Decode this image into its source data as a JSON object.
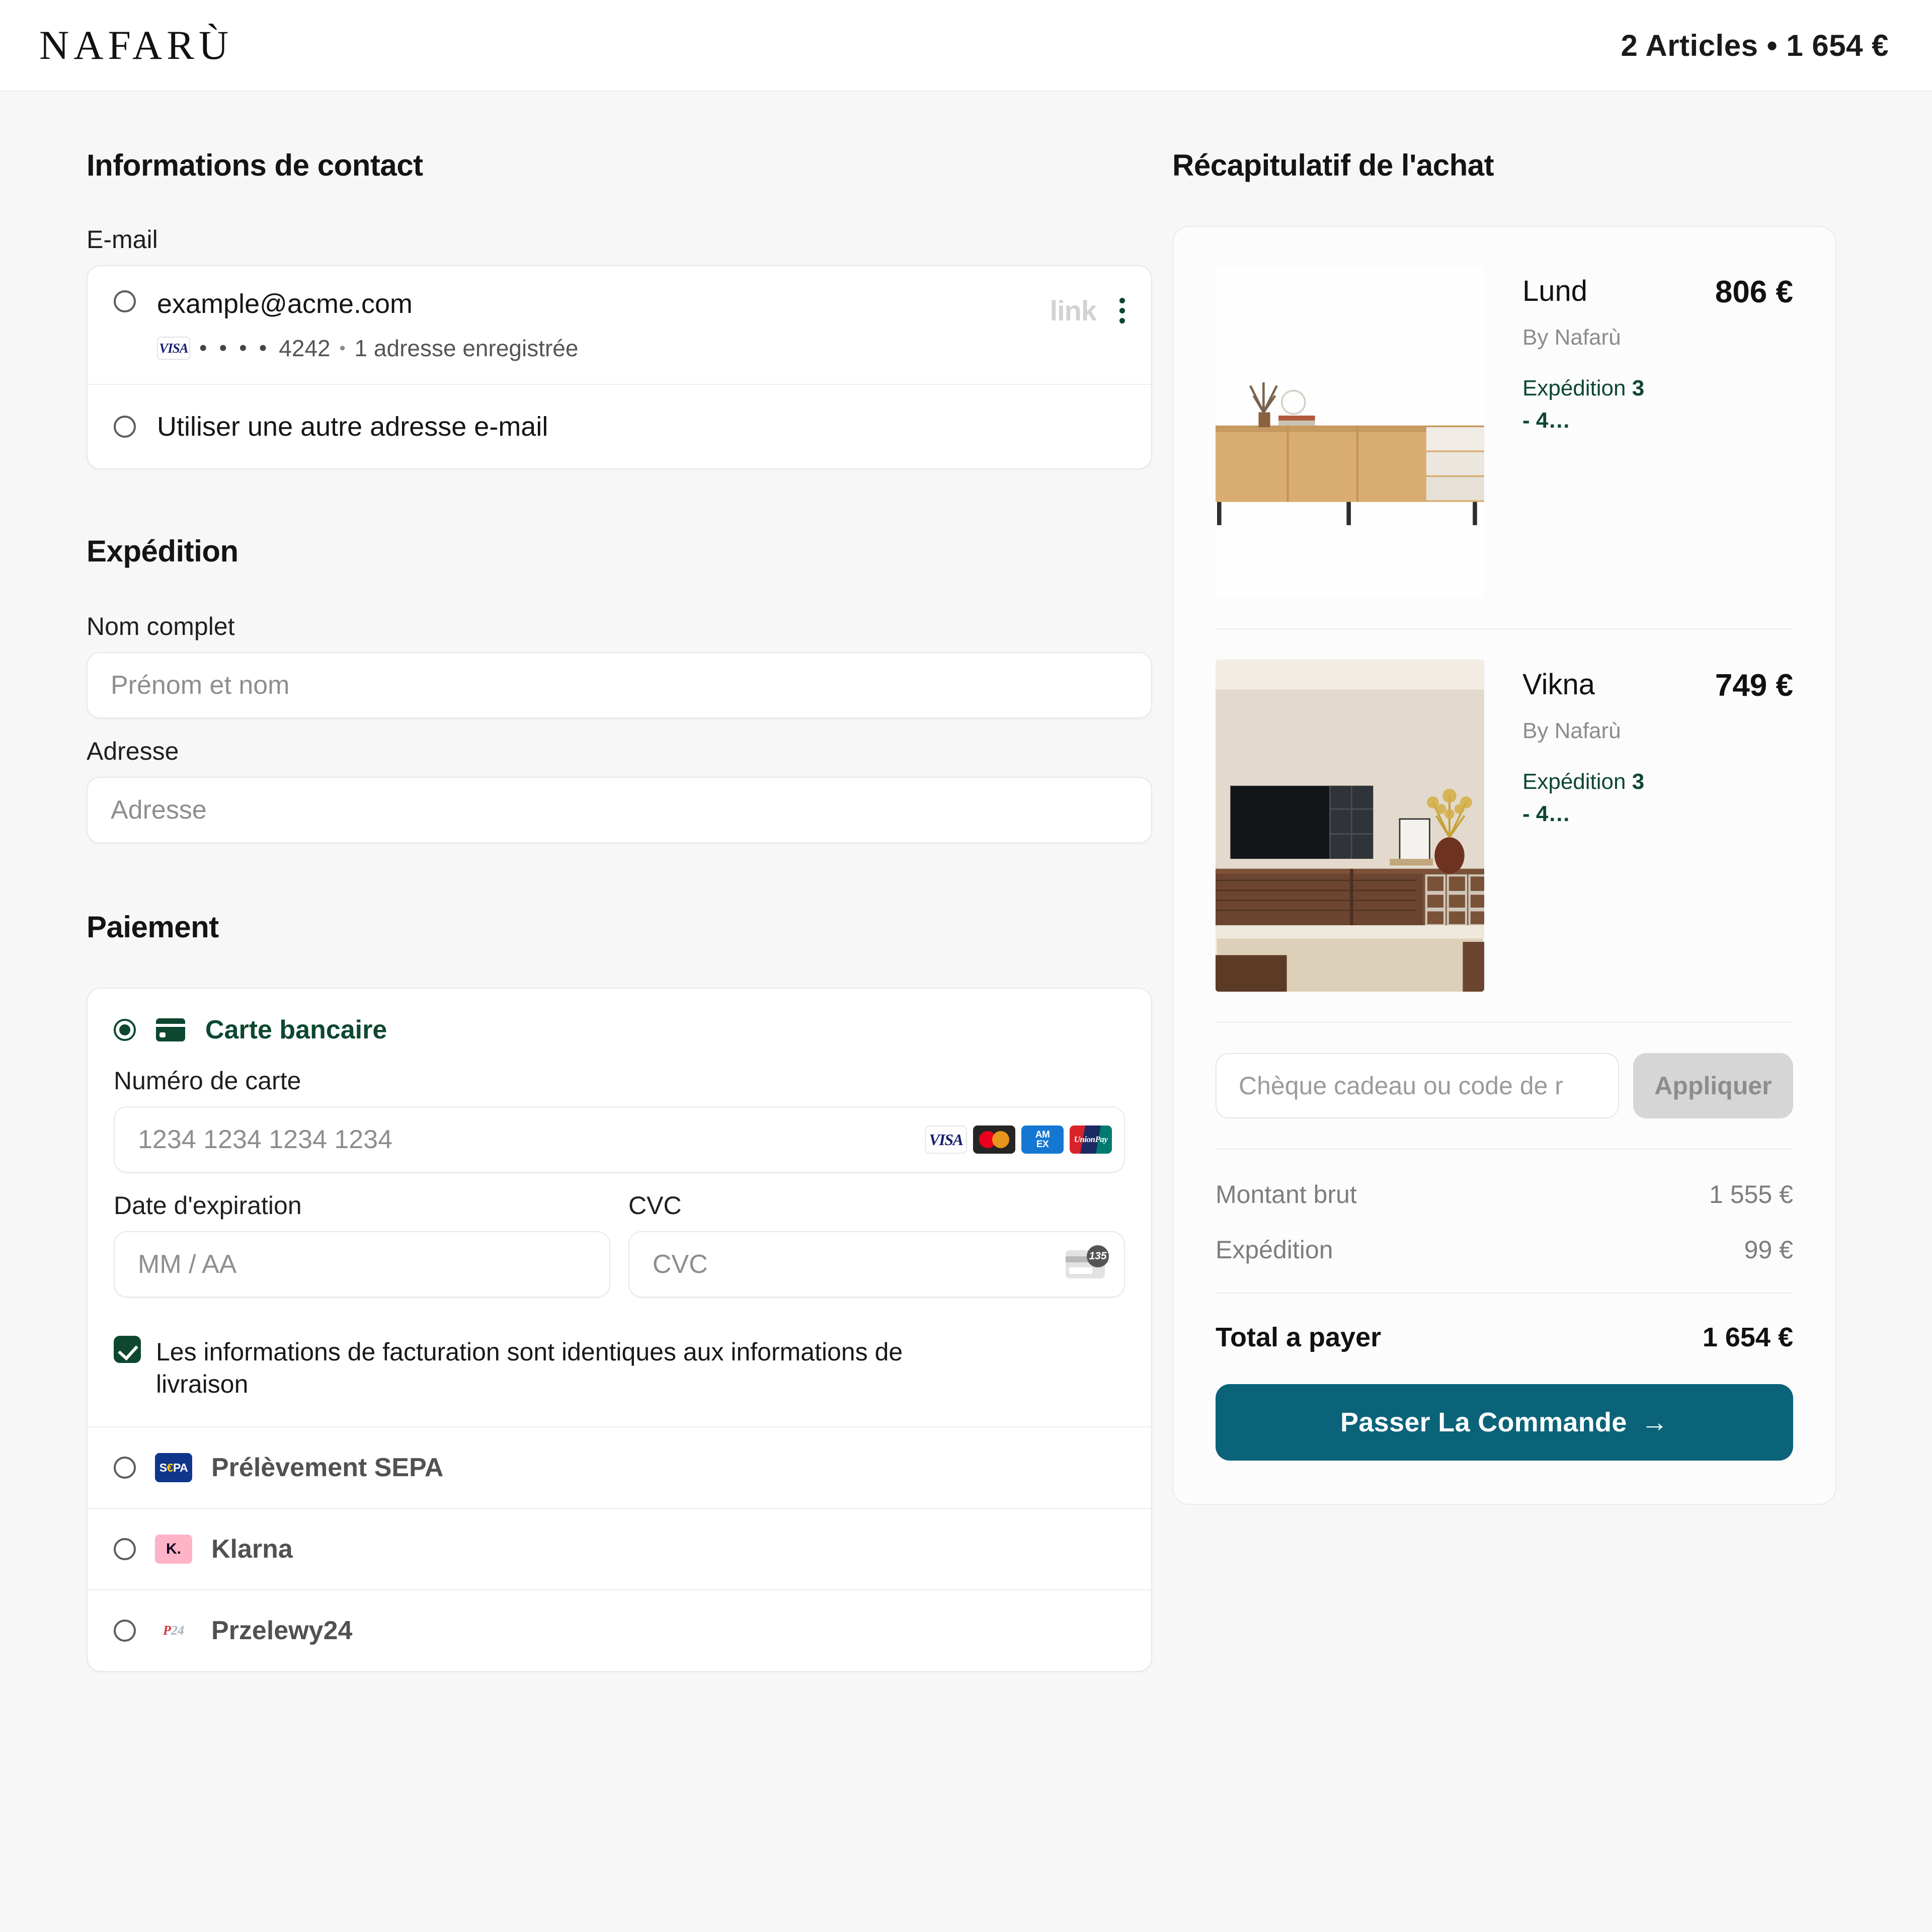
{
  "header": {
    "brand": "NAFARÙ",
    "cart_summary": "2 Articles • 1 654 €"
  },
  "contact": {
    "title": "Informations de contact",
    "email_label": "E-mail",
    "saved": {
      "email": "example@acme.com",
      "card_brand": "VISA",
      "masked_digits": "• • • •",
      "last4": "4242",
      "separator": "•",
      "address_note": "1 adresse enregistrée",
      "wallet_logo": "link"
    },
    "other_email_option": "Utiliser une autre adresse e-mail"
  },
  "shipping": {
    "title": "Expédition",
    "fullname_label": "Nom complet",
    "fullname_placeholder": "Prénom et nom",
    "address_label": "Adresse",
    "address_placeholder": "Adresse"
  },
  "payment": {
    "title": "Paiement",
    "card_option_label": "Carte bancaire",
    "card_number_label": "Numéro de carte",
    "card_number_placeholder": "1234 1234 1234 1234",
    "expiry_label": "Date d'expiration",
    "expiry_placeholder": "MM / AA",
    "cvc_label": "CVC",
    "cvc_placeholder": "CVC",
    "cvc_icon_digits": "135",
    "billing_checkbox_label": "Les informations de facturation sont identiques aux informations de livraison",
    "accepted_brands": [
      "VISA",
      "Mastercard",
      "AMEX",
      "UnionPay"
    ],
    "amex_line1": "AM",
    "amex_line2": "EX",
    "unionpay_label": "UnionPay",
    "sepa_logo_s": "S",
    "sepa_logo_euro": "€",
    "sepa_logo_pa": "PA",
    "klarna_logo": "K.",
    "p24_logo_p": "P",
    "p24_logo_24": "24",
    "methods": [
      {
        "label": "Prélèvement SEPA"
      },
      {
        "label": "Klarna"
      },
      {
        "label": "Przelewy24"
      }
    ]
  },
  "summary": {
    "title": "Récapitulatif de l'achat",
    "items": [
      {
        "name": "Lund",
        "price": "806 €",
        "vendor": "By Nafarù",
        "shipping_prefix": "Expédition ",
        "shipping_days": "3",
        "shipping_suffix": "- 4…"
      },
      {
        "name": "Vikna",
        "price": "749 €",
        "vendor": "By Nafarù",
        "shipping_prefix": "Expédition ",
        "shipping_days": "3",
        "shipping_suffix": "- 4…"
      }
    ],
    "promo_placeholder": "Chèque cadeau ou code de r",
    "promo_button": "Appliquer",
    "totals": [
      {
        "label": "Montant brut",
        "value": "1 555 €"
      },
      {
        "label": "Expédition",
        "value": "99 €"
      }
    ],
    "grand_total_label": "Total a payer",
    "grand_total_value": "1 654 €",
    "cta_label": "Passer La Commande",
    "cta_arrow": "→"
  },
  "colors": {
    "accent_green": "#0d4730",
    "cta_teal": "#0b6379",
    "page_bg": "#f7f7f7"
  }
}
